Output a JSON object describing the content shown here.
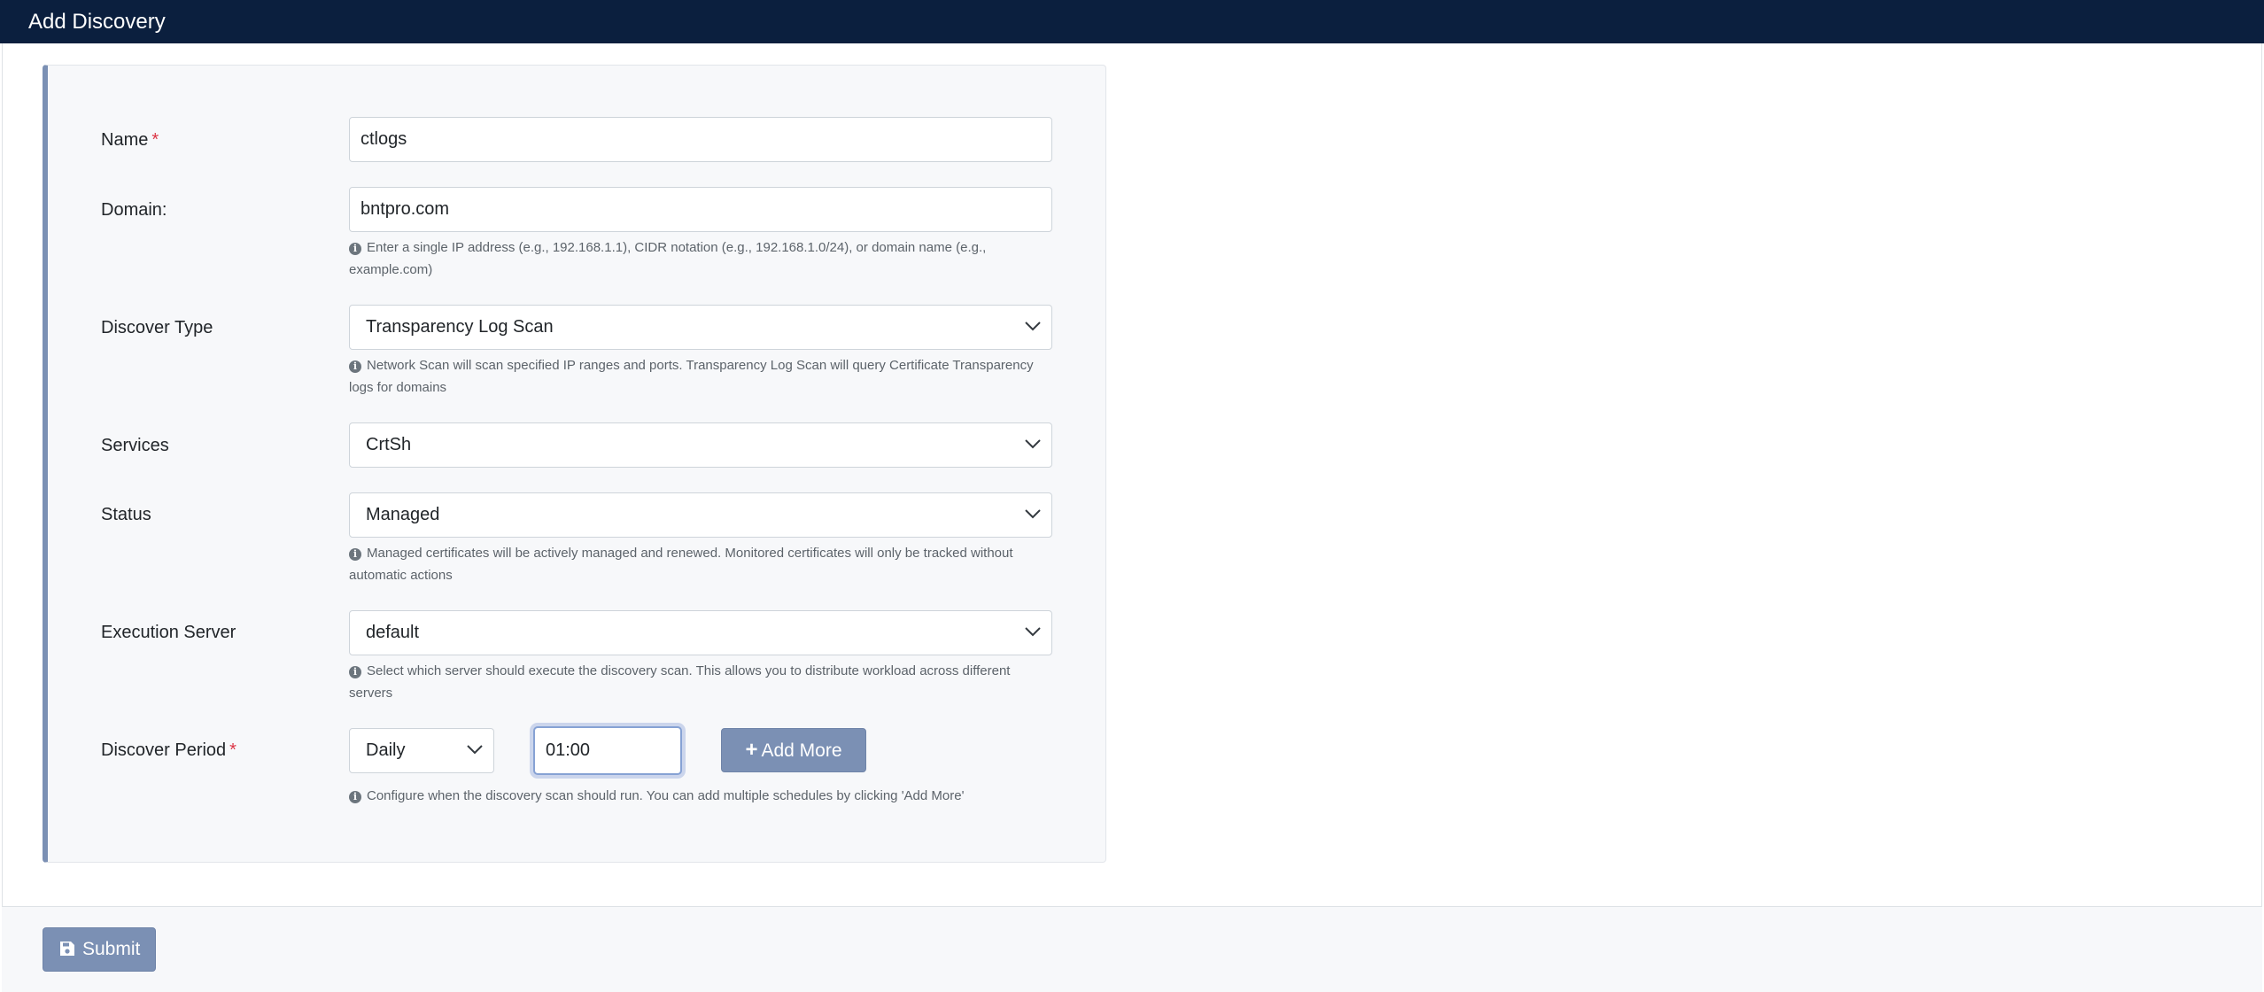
{
  "header": {
    "title": "Add Discovery"
  },
  "form": {
    "name": {
      "label": "Name",
      "required_mark": "*",
      "value": "ctlogs"
    },
    "domain": {
      "label": "Domain:",
      "value": "bntpro.com",
      "help_line1": "Enter a single IP address (e.g., 192.168.1.1), CIDR notation (e.g., 192.168.1.0/24), or domain name (e.g.,",
      "help_line2": "example.com)"
    },
    "discover_type": {
      "label": "Discover Type",
      "value": "Transparency Log Scan",
      "help_line1": "Network Scan will scan specified IP ranges and ports. Transparency Log Scan will query Certificate Transparency",
      "help_line2": "logs for domains"
    },
    "services": {
      "label": "Services",
      "value": "CrtSh"
    },
    "status": {
      "label": "Status",
      "value": "Managed",
      "help_line1": "Managed certificates will be actively managed and renewed. Monitored certificates will only be tracked without",
      "help_line2": "automatic actions"
    },
    "execution_server": {
      "label": "Execution Server",
      "value": "default",
      "help_line1": "Select which server should execute the discovery scan. This allows you to distribute workload across different",
      "help_line2": "servers"
    },
    "discover_period": {
      "label": "Discover Period",
      "required_mark": "*",
      "frequency": "Daily",
      "time": "01:00",
      "add_more_label": "Add More",
      "help": "Configure when the discovery scan should run. You can add multiple schedules by clicking 'Add More'"
    }
  },
  "footer": {
    "submit_label": "Submit"
  },
  "icons": {
    "info": "info-circle-icon",
    "chevron": "chevron-down-icon",
    "plus": "plus-icon",
    "save": "floppy-disk-icon"
  },
  "colors": {
    "titlebar": "#0b1f3e",
    "accent": "#7b90b4",
    "required": "#dc3545"
  }
}
